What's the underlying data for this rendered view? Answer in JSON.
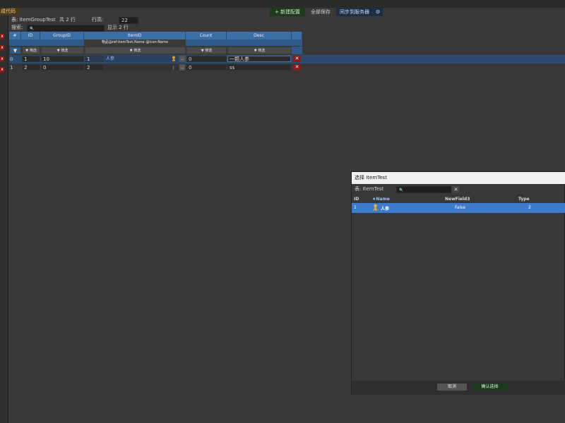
{
  "toolbar": {
    "gen_code": "成代码",
    "new_config": "+ 新建配置",
    "save_all": "全部保存",
    "sync_server": "同步到服务器",
    "gear": "⚙"
  },
  "info": {
    "table_label": "表: ItemGroupTest",
    "total": "共 2 行",
    "row_height_label": "行高:",
    "row_height_value": "22",
    "search_label": "搜索:",
    "search_icon": "🔍",
    "showing": "显示 2 行"
  },
  "left_strip": {
    "x": "x"
  },
  "grid": {
    "headers": [
      "#",
      "ID",
      "GroupID",
      "ItemID",
      "Count",
      "Desc"
    ],
    "itemid_sub": "物品@ref:ItemTest.Name @icon:Name",
    "filter_arrow": "▼",
    "filter_label": "▼ 筛选",
    "rows": [
      {
        "idx": "0",
        "id": "1",
        "group": "10",
        "item": "1",
        "item_name": "人参",
        "count": "0",
        "desc": "一颗人参",
        "selected": true
      },
      {
        "idx": "1",
        "id": "2",
        "group": "0",
        "item": "2",
        "item_name": "",
        "count": "0",
        "desc": "ss",
        "selected": false
      }
    ],
    "pick_label": "..",
    "del_label": "✕"
  },
  "dialog": {
    "title": "选择 ItemTest",
    "table_label": "表: ItemTest",
    "search_icon": "🔍",
    "clear": "✕",
    "columns": [
      "ID",
      "★Name",
      "NewField3",
      "Type"
    ],
    "rows": [
      {
        "id": "1",
        "name": "人参",
        "newfield3": "False",
        "type": "2"
      }
    ],
    "cancel": "取消",
    "confirm": "确认选择"
  },
  "colors": {
    "accent": "#3b6fa8",
    "selection": "#3d7ccc",
    "danger": "#8b1a1a",
    "confirm_bg": "#1e3a1e"
  }
}
